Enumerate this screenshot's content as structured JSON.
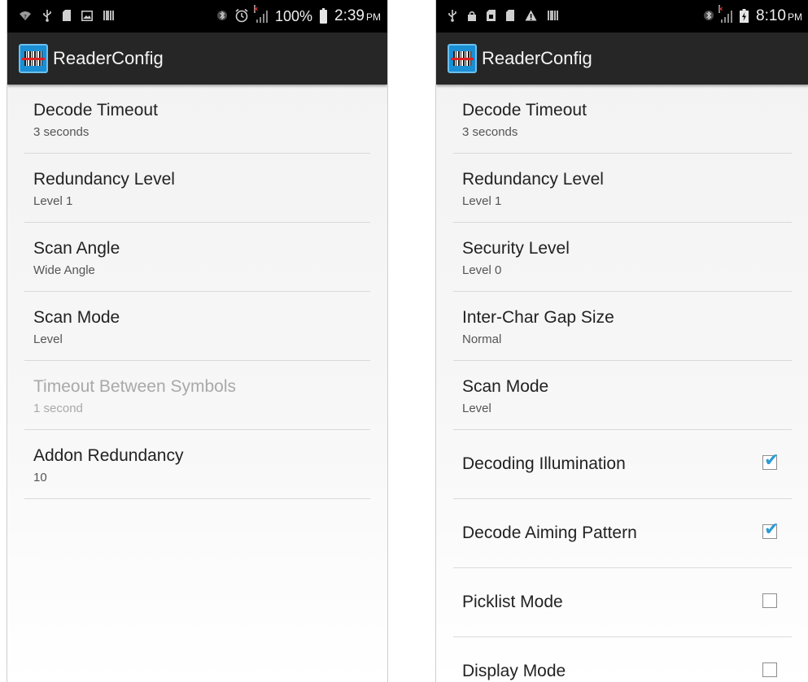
{
  "left": {
    "status": {
      "battery": "100%",
      "time": "2:39",
      "ampm": "PM"
    },
    "app_title": "ReaderConfig",
    "prefs": [
      {
        "title": "Decode Timeout",
        "summary": "3 seconds"
      },
      {
        "title": "Redundancy Level",
        "summary": "Level 1"
      },
      {
        "title": "Scan Angle",
        "summary": "Wide Angle"
      },
      {
        "title": "Scan Mode",
        "summary": "Level"
      },
      {
        "title": "Timeout Between Symbols",
        "summary": "1 second",
        "enabled": false
      },
      {
        "title": "Addon Redundancy",
        "summary": "10"
      }
    ]
  },
  "right": {
    "status": {
      "time": "8:10",
      "ampm": "PM"
    },
    "app_title": "ReaderConfig",
    "prefs": [
      {
        "title": "Decode Timeout",
        "summary": "3 seconds"
      },
      {
        "title": "Redundancy Level",
        "summary": "Level 1"
      },
      {
        "title": "Security Level",
        "summary": "Level 0"
      },
      {
        "title": "Inter-Char Gap Size",
        "summary": "Normal"
      },
      {
        "title": "Scan Mode",
        "summary": "Level"
      }
    ],
    "checkboxes": [
      {
        "title": "Decoding Illumination",
        "checked": true
      },
      {
        "title": "Decode Aiming Pattern",
        "checked": true
      },
      {
        "title": "Picklist Mode",
        "checked": false
      },
      {
        "title": "Display Mode",
        "checked": false
      }
    ]
  },
  "icons": {
    "status_left_left": [
      "wifi-icon",
      "usb-icon",
      "sd-card-icon",
      "image-icon",
      "barcode-icon"
    ],
    "status_left_right": [
      "bluetooth-icon",
      "alarm-icon",
      "signal-icon",
      "battery-icon"
    ],
    "status_right_left": [
      "usb-icon",
      "lock-icon",
      "sim-icon",
      "sd-card-icon",
      "warning-icon",
      "barcode-icon"
    ],
    "status_right_right": [
      "bluetooth-icon",
      "signal-icon",
      "battery-charging-icon"
    ],
    "app": "reader-config-barcode-icon"
  },
  "colors": {
    "accent": "#2b9bd7",
    "action_bar": "#262626",
    "status_bar": "#000000",
    "laser": "#e02020"
  }
}
